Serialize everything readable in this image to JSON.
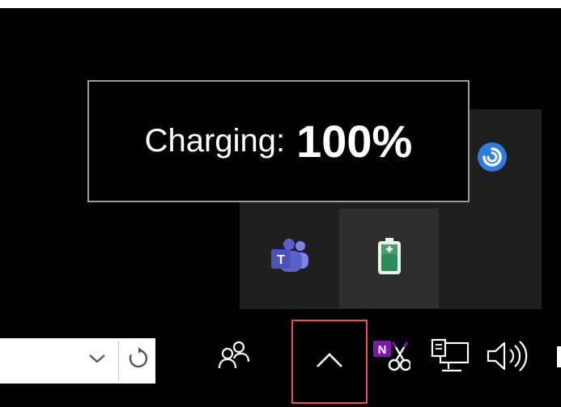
{
  "tooltip": {
    "label": "Charging:",
    "value": "100%"
  },
  "tray_overflow": {
    "icons": [
      {
        "name": "cortana-like-app-icon",
        "color": "#2f7de1"
      },
      {
        "name": "teams-icon",
        "color": "#5b5fc7"
      },
      {
        "name": "battery-charging-icon",
        "color": "#2e8b57"
      }
    ]
  },
  "taskbar": {
    "address_box": {
      "value": ""
    },
    "icons": [
      "people-icon",
      "show-hidden-icons-chevron",
      "onenote-clipper-icon",
      "network-icon",
      "volume-icon"
    ]
  },
  "colors": {
    "highlight_border": "#e8514c",
    "flyout_bg": "#1f1f1f"
  }
}
